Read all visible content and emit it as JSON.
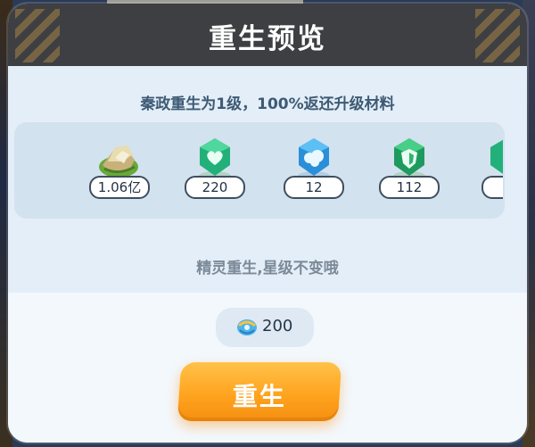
{
  "dialog": {
    "title": "重生预览",
    "subtitle": "秦政重生为1级，100%返还升级材料",
    "rewards": [
      {
        "icon": "gold-ingot-pile-icon",
        "count": "1.06亿"
      },
      {
        "icon": "green-heart-crystal-icon",
        "count": "220"
      },
      {
        "icon": "blue-cloud-crystal-icon",
        "count": "12"
      },
      {
        "icon": "green-shield-crystal-icon",
        "count": "112"
      },
      {
        "icon": "green-crystal-partial-icon",
        "count": ""
      }
    ],
    "hint": "精灵重生,星级不变哦",
    "cost": {
      "icon": "blue-gem-currency-icon",
      "value": "200"
    },
    "button_label": "重生"
  },
  "colors": {
    "header_bg": "#3e3f42",
    "panel_bg": "#e3eef8",
    "button_orange": "#ffa41f"
  }
}
